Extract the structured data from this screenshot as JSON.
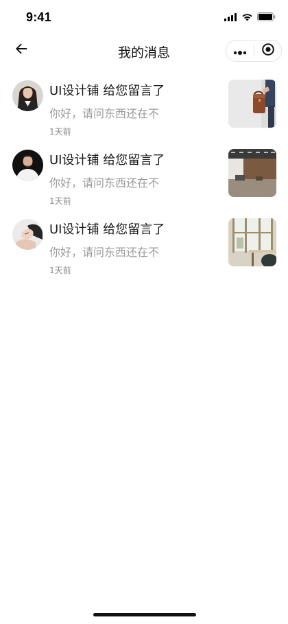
{
  "status_bar": {
    "time": "9:41",
    "icons": [
      "cellular-signal-icon",
      "wifi-icon",
      "battery-icon"
    ]
  },
  "nav": {
    "title": "我的消息",
    "back_icon": "arrow-left-icon",
    "more_icon": "more-dots-icon",
    "close_icon": "target-circle-icon"
  },
  "messages": [
    {
      "title": "UI设计铺 给您留言了",
      "preview": "你好，请问东西还在不",
      "time": "1天前",
      "avatar": "avatar-woman-dark-hair",
      "thumbnail": "photo-brown-briefcase"
    },
    {
      "title": "UI设计铺 给您留言了",
      "preview": "你好，请问东西还在不",
      "time": "1天前",
      "avatar": "avatar-man-dark-background",
      "thumbnail": "photo-office-interior"
    },
    {
      "title": "UI设计铺 给您留言了",
      "preview": "你好，请问东西还在不",
      "time": "1天前",
      "avatar": "avatar-woman-lying",
      "thumbnail": "photo-window-table"
    }
  ],
  "colors": {
    "title": "#1a1a1a",
    "preview": "#9b9b9b",
    "time": "#8a8a8a",
    "background": "#ffffff"
  }
}
